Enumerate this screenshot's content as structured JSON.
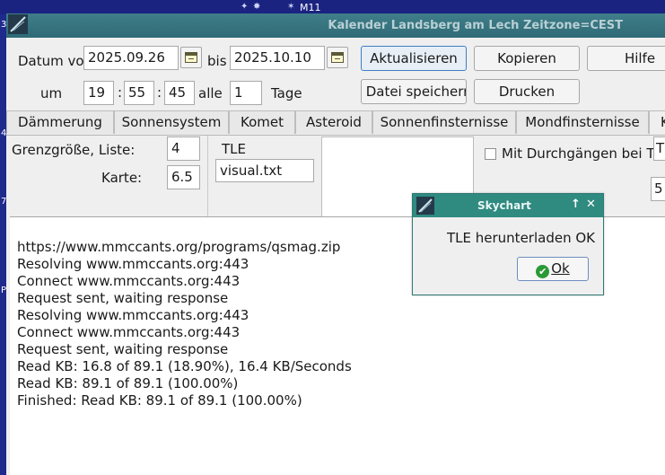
{
  "background": {
    "sky_label": "M11",
    "side_numbers": [
      "3",
      "4",
      "7",
      "PI"
    ]
  },
  "window": {
    "title": "Kalender Landsberg am Lech Zeitzone=CEST"
  },
  "form": {
    "date_from_label": "Datum vom",
    "date_from_value": "2025.09.26",
    "date_to_label": "bis",
    "date_to_value": "2025.10.10",
    "time_label": "um",
    "hour": "19",
    "minute": "55",
    "second": "45",
    "time_separator": ":",
    "step_label": "alle",
    "step_value": "1",
    "step_unit": "Tage"
  },
  "buttons": {
    "refresh": "Aktualisieren",
    "copy": "Kopieren",
    "help": "Hilfe",
    "save_file": "In Datei speichern",
    "print": "Drucken"
  },
  "tabs": [
    {
      "label": "Dämmerung"
    },
    {
      "label": "Sonnensystem"
    },
    {
      "label": "Komet"
    },
    {
      "label": "Asteroid"
    },
    {
      "label": "Sonnenfinsternisse"
    },
    {
      "label": "Mondfinsternisse"
    },
    {
      "label": "K"
    }
  ],
  "satellite_panel": {
    "limit_list_label": "Grenzgröße, Liste:",
    "limit_list_value": "4",
    "map_label": "Karte:",
    "map_value": "6.5",
    "tle_label": "TLE",
    "tle_file": "visual.txt",
    "transits_checkbox_label": "Mit Durchgängen bei Tag",
    "transits_checked": false,
    "right_field_partial": "TL",
    "right_value_partial": "5"
  },
  "output_lines": [
    "https://www.mmccants.org/programs/qsmag.zip",
    "Resolving www.mmccants.org:443",
    "Connect www.mmccants.org:443",
    "Request sent, waiting response",
    "Resolving www.mmccants.org:443",
    "Connect www.mmccants.org:443",
    "Request sent, waiting response",
    "Read KB: 16.8 of 89.1 (18.90%), 16.4 KB/Seconds",
    "Read KB: 89.1 of 89.1 (100.00%)",
    "Finished: Read KB: 89.1 of 89.1 (100.00%)"
  ],
  "dialog": {
    "title": "Skychart",
    "message": "TLE herunterladen OK",
    "ok_label": "Ok",
    "ctl_up": "↑",
    "ctl_close": "✕"
  },
  "colors": {
    "sky_background": "#1e2a8c",
    "titlebar": "#3f7e8a",
    "dialog_titlebar": "#2f8a80",
    "ok_icon": "#2a9a34"
  },
  "icons": {
    "window_icon": "skychart-app-icon",
    "calendar_icon": "calendar-icon",
    "ok_icon": "checkmark-circle-icon"
  }
}
